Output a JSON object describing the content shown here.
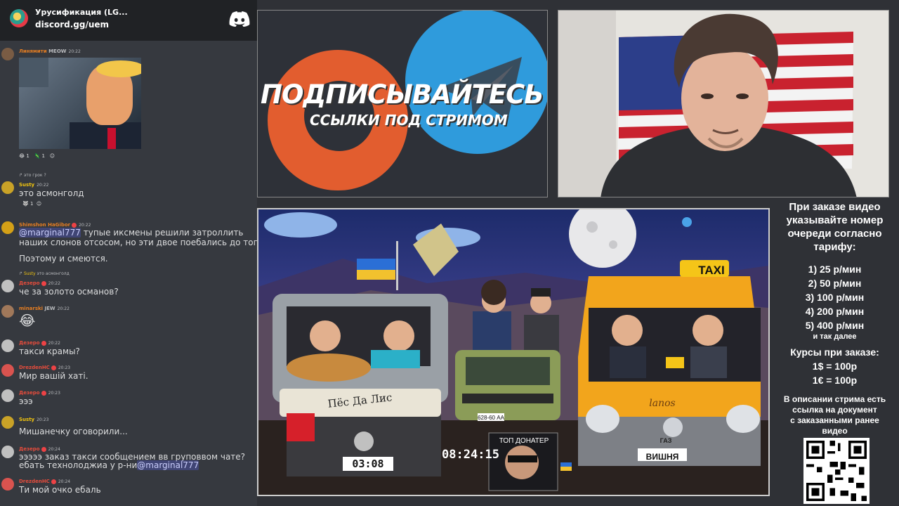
{
  "discord": {
    "server_name": "Урусификация (LG...",
    "invite": "discord.gg/uem",
    "messages": [
      {
        "user": "Линямити",
        "badge": "MEOW",
        "time": "20:22",
        "color": "#e67e22"
      },
      {
        "reactions": [
          "1",
          "1"
        ]
      },
      {
        "reply": "это грок ?",
        "user": "Susty",
        "time": "20:22",
        "color": "#f1c40f",
        "text": "это асмонголд",
        "reactions": [
          "1"
        ]
      },
      {
        "user": "Shimshon HaGibor",
        "time": "20:22",
        "color": "#e67e22",
        "mention": "@marginal777",
        "text1": " тупые иксмены решили затроллить",
        "text2": "наших слонов отсосом, но эти двое поебались до того",
        "text3": "Поэтому и смеются."
      },
      {
        "reply": "это асмонголд",
        "user": "Дезеро",
        "time": "20:22",
        "color": "#e74c3c",
        "text": "че за золото османов?"
      },
      {
        "user": "minarski",
        "badge": "JEW",
        "time": "20:22",
        "color": "#e67e22",
        "text": "😂"
      },
      {
        "user": "Дезеро",
        "time": "20:22",
        "color": "#e74c3c",
        "text": "такси крамы?"
      },
      {
        "user": "DrezdenHC",
        "time": "20:23",
        "color": "#e74c3c",
        "text": "Мир вашій хаті."
      },
      {
        "user": "Дезеро",
        "time": "20:23",
        "color": "#e74c3c",
        "text": "эээ"
      },
      {
        "user": "Susty",
        "time": "20:23",
        "color": "#f1c40f",
        "text": "Мишанечку оговорили..."
      },
      {
        "user": "Дезеро",
        "time": "20:24",
        "color": "#e74c3c",
        "text1": "эээээ заказ такси сообщением вв груповвом чате?",
        "text2": "ебать технолоджиа у р-ни",
        "mention": "@marginal777"
      },
      {
        "user": "DrezdenHC",
        "time": "20:24",
        "color": "#e74c3c",
        "text": "Ти мой очко ебаль"
      }
    ]
  },
  "promo": {
    "title": "ПОДПИСЫВАЙТЕСЬ",
    "subtitle": "ССЫЛКИ ПОД СТРИМОМ"
  },
  "game": {
    "sign": "Пёс Да Лис",
    "taxi": "TAXI",
    "plate": "ВИШНЯ",
    "car_plate": "628-60 АА",
    "top_donater": "ТОП ДОНАТЕР",
    "stream_time": "08:24:15",
    "small_timer": "03:08",
    "van_brand": "lanos",
    "gaz": "ГАЗ"
  },
  "info": {
    "heading": [
      "При заказе видео",
      "указывайте номер",
      "очереди согласно",
      "тарифу:"
    ],
    "prices": [
      "1) 25 р/мин",
      "2) 50 р/мин",
      "3) 100 р/мин",
      "4) 200 р/мин",
      "5) 400 р/мин"
    ],
    "etc": "и так далее",
    "courses_title": "Курсы при заказе:",
    "courses": [
      "1$ = 100р",
      "1€ = 100р"
    ],
    "desc": [
      "В описании стрима есть",
      "ссылка на документ",
      "с заказанными ранее",
      "видео"
    ]
  }
}
